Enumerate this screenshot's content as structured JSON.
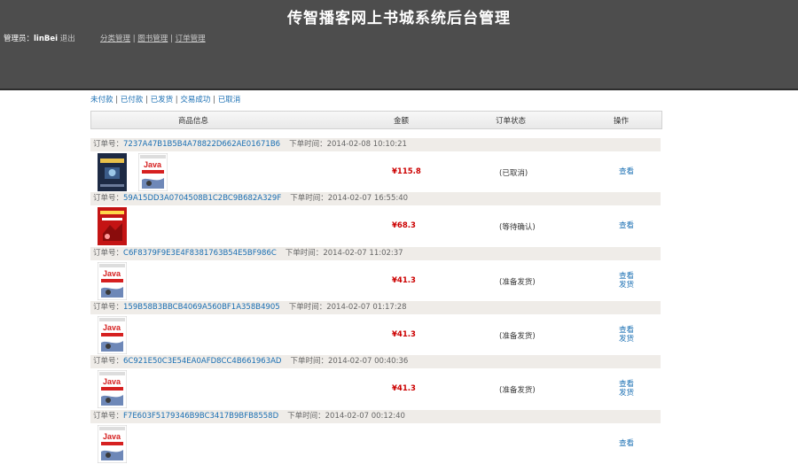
{
  "header": {
    "title": "传智播客网上书城系统后台管理",
    "admin_label": "管理员：",
    "admin_name": "linBei",
    "logout": "退出",
    "nav": [
      "分类管理",
      "图书管理",
      "订单管理"
    ]
  },
  "filter": [
    "未付款",
    "已付款",
    "已发货",
    "交易成功",
    "已取消"
  ],
  "table_head": {
    "goods": "商品信息",
    "amount": "金额",
    "status": "订单状态",
    "ops": "操作"
  },
  "labels": {
    "order_no": "订单号：",
    "order_time": "下单时间："
  },
  "orders": [
    {
      "id": "7237A47B1B5B4A78822D662AE01671B6",
      "time": "2014-02-08 10:10:21",
      "price": "¥115.8",
      "status": "(已取消)",
      "ops": [
        "查看"
      ],
      "books": [
        "dark",
        "java"
      ]
    },
    {
      "id": "59A15DD3A0704508B1C2BC9B682A329F",
      "time": "2014-02-07 16:55:40",
      "price": "¥68.3",
      "status": "(等待确认)",
      "ops": [
        "查看"
      ],
      "books": [
        "red"
      ]
    },
    {
      "id": "C6F8379F9E3E4F8381763B54E5BF986C",
      "time": "2014-02-07 11:02:37",
      "price": "¥41.3",
      "status": "(准备发货)",
      "ops": [
        "查看",
        "发货"
      ],
      "books": [
        "java"
      ]
    },
    {
      "id": "159B58B3BBCB4069A560BF1A358B4905",
      "time": "2014-02-07 01:17:28",
      "price": "¥41.3",
      "status": "(准备发货)",
      "ops": [
        "查看",
        "发货"
      ],
      "books": [
        "java"
      ]
    },
    {
      "id": "6C921E50C3E54EA0AFD8CC4B661963AD",
      "time": "2014-02-07 00:40:36",
      "price": "¥41.3",
      "status": "(准备发货)",
      "ops": [
        "查看",
        "发货"
      ],
      "books": [
        "java"
      ]
    },
    {
      "id": "F7E603F5179346B9BC3417B9BFB8558D",
      "time": "2014-02-07 00:12:40",
      "price": "",
      "status": "",
      "ops": [
        "查看"
      ],
      "books": [
        "java"
      ]
    }
  ],
  "colors": {
    "header_bg": "#4d4d4d",
    "link": "#1a6fb3",
    "price": "#cc0000",
    "row_bar": "#efece8"
  }
}
